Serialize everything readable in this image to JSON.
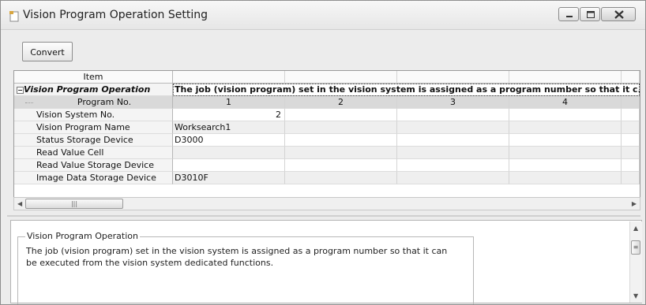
{
  "window": {
    "title": "Vision Program Operation Setting"
  },
  "toolbar": {
    "convert_label": "Convert"
  },
  "grid": {
    "header_item": "Item",
    "root_label": "Vision Program Operation",
    "root_description": "The job (vision program) set in the vision system is assigned as a program number so that it c...",
    "program_numbers": [
      "1",
      "2",
      "3",
      "4"
    ],
    "rows": [
      {
        "label": "Program No."
      },
      {
        "label": "Vision System No.",
        "value": "2"
      },
      {
        "label": "Vision Program Name",
        "value": "Worksearch1"
      },
      {
        "label": "Status Storage Device",
        "value": "D3000"
      },
      {
        "label": "Read Value Cell",
        "value": ""
      },
      {
        "label": "Read Value Storage Device",
        "value": ""
      },
      {
        "label": "Image Data Storage Device",
        "value": "D3010F"
      }
    ]
  },
  "description_panel": {
    "title": "Vision Program Operation",
    "text": "The job (vision program) set in the vision system is assigned as a program number so that it can be executed from the vision system dedicated functions."
  },
  "icons": {
    "window": "document-icon",
    "minimize": "minimize-icon",
    "maximize": "maximize-icon",
    "close": "close-icon",
    "collapse": "minus-box-icon"
  }
}
